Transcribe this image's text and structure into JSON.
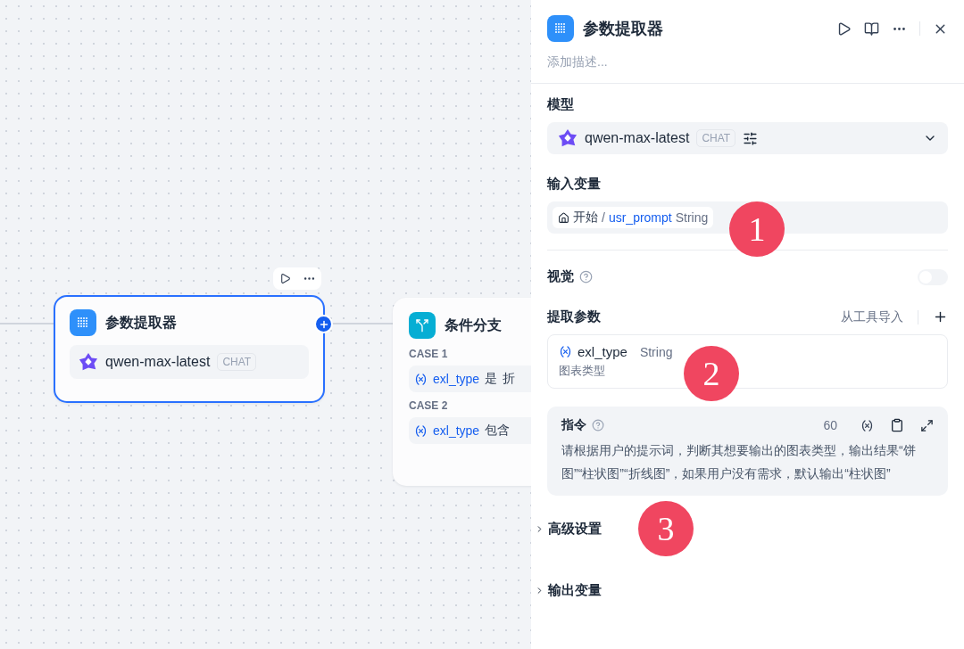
{
  "canvas": {
    "nodes": [
      {
        "kind": "llm",
        "title": "参数提取器",
        "selected": true,
        "model": "qwen-max-latest",
        "mode": "CHAT"
      },
      {
        "kind": "condition",
        "title": "条件分支",
        "selected": false,
        "cases": [
          {
            "label": "CASE 1",
            "variable": "exl_type",
            "operator": "是",
            "value": "折"
          },
          {
            "label": "CASE 2",
            "variable": "exl_type",
            "operator": "包含"
          }
        ]
      }
    ]
  },
  "panel": {
    "title": "参数提取器",
    "description_placeholder": "添加描述...",
    "model": {
      "label": "模型",
      "name": "qwen-max-latest",
      "mode": "CHAT"
    },
    "input": {
      "label": "输入变量",
      "source": "开始",
      "separator": "/",
      "variable": "usr_prompt",
      "type": "String"
    },
    "vision": {
      "label": "视觉",
      "on": false
    },
    "params": {
      "label": "提取参数",
      "import": "从工具导入",
      "items": [
        {
          "name": "exl_type",
          "type": "String",
          "description": "图表类型"
        }
      ]
    },
    "instruction": {
      "label": "指令",
      "count": "60",
      "text": "请根据用户的提示词，判断其想要输出的图表类型，输出结果“饼图”“柱状图”“折线图”，如果用户没有需求，默认输出“柱状图”"
    },
    "sections": [
      {
        "label": "高级设置",
        "expanded": false
      },
      {
        "label": "输出变量",
        "expanded": false
      }
    ]
  },
  "annotations": [
    {
      "label": "1"
    },
    {
      "label": "2"
    },
    {
      "label": "3"
    }
  ]
}
